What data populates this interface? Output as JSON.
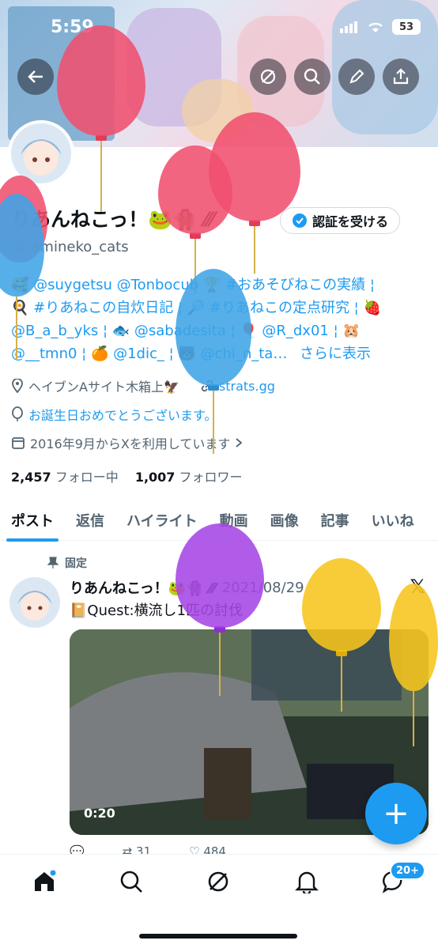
{
  "status": {
    "time": "5:59",
    "battery": "53"
  },
  "profile": {
    "name": "りあんねこっ！🐸🧌 ⁄⁄⁄",
    "verify_label": "認証を受ける",
    "handle": "@ramineko_cats",
    "bio_lines": [
      "🥰 @suygetsu @Tonbocub 🏆 #おあそびねこの実績 ¦",
      "🍳 #りあねこの自炊日記 ¦ 🔎 #りあねこの定点研究 ¦ 🍓",
      "@B_a_b_yks ¦ 🐟 @sabadesita ¦ 🎈 @R_dx01 ¦ 🐹",
      "@__tmn0 ¦ 🍊 @1dic_ ¦ 🐻 @chi_n_ta…"
    ],
    "show_more": "さらに表示",
    "location": "ヘイブンAサイト木箱上🦅",
    "website": "strats.gg",
    "birthday": "お誕生日おめでとうございます。",
    "joined": "2016年9月からXを利用しています",
    "following_count": "2,457",
    "following_label": "フォロー中",
    "followers_count": "1,007",
    "followers_label": "フォロワー"
  },
  "tabs": [
    "ポスト",
    "返信",
    "ハイライト",
    "動画",
    "画像",
    "記事",
    "いいね"
  ],
  "post": {
    "pinned_label": "固定",
    "author": "りあんねこっ！🐸🧌 ⁄⁄⁄",
    "date": "2021/08/29",
    "text": "📔Quest:横流し1匹の討伐",
    "video_time": "0:20",
    "retweets": "31",
    "likes": "484"
  },
  "nav": {
    "messages_badge": "20+"
  },
  "fab_label": "+",
  "colors": {
    "accent": "#1d9bf0",
    "text": "#0f1419",
    "muted": "#536471"
  },
  "icons": [
    "back-arrow-icon",
    "grok-icon",
    "search-icon",
    "edit-icon",
    "share-icon",
    "verified-badge-icon",
    "location-icon",
    "link-icon",
    "balloon-icon",
    "calendar-icon",
    "pin-icon",
    "x-logo-icon",
    "home-icon",
    "notifications-icon",
    "messages-icon"
  ]
}
